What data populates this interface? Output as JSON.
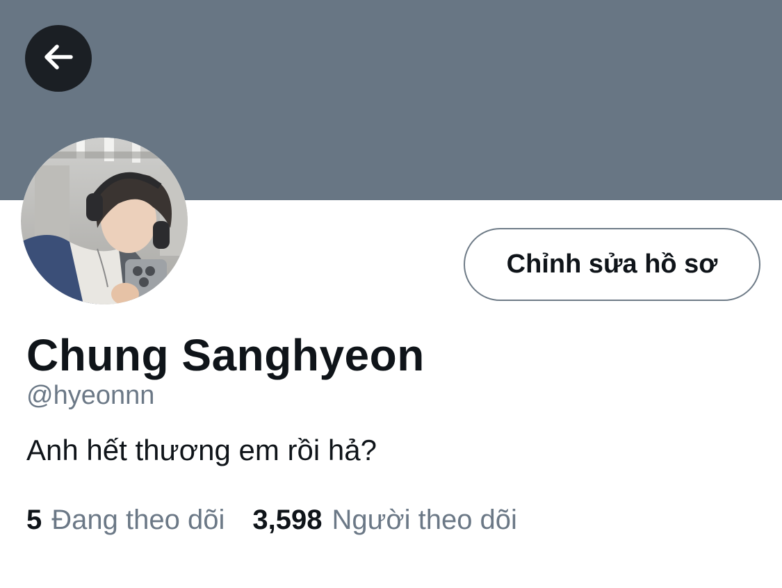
{
  "colors": {
    "banner": "#687684",
    "back_button": "#1b1f24",
    "text_primary": "#0f1419",
    "text_secondary": "#6b7886",
    "button_border": "#6d7a86"
  },
  "header": {
    "back_icon": "arrow-left-icon"
  },
  "profile": {
    "avatar_icon": "profile-photo",
    "edit_button_label": "Chỉnh sửa hồ sơ",
    "display_name": "Chung Sanghyeon",
    "handle": "@hyeonnn",
    "bio": "Anh hết thương em rồi hả?"
  },
  "stats": {
    "following_count": "5",
    "following_label": "Đang theo dõi",
    "followers_count": "3,598",
    "followers_label": "Người theo dõi"
  }
}
